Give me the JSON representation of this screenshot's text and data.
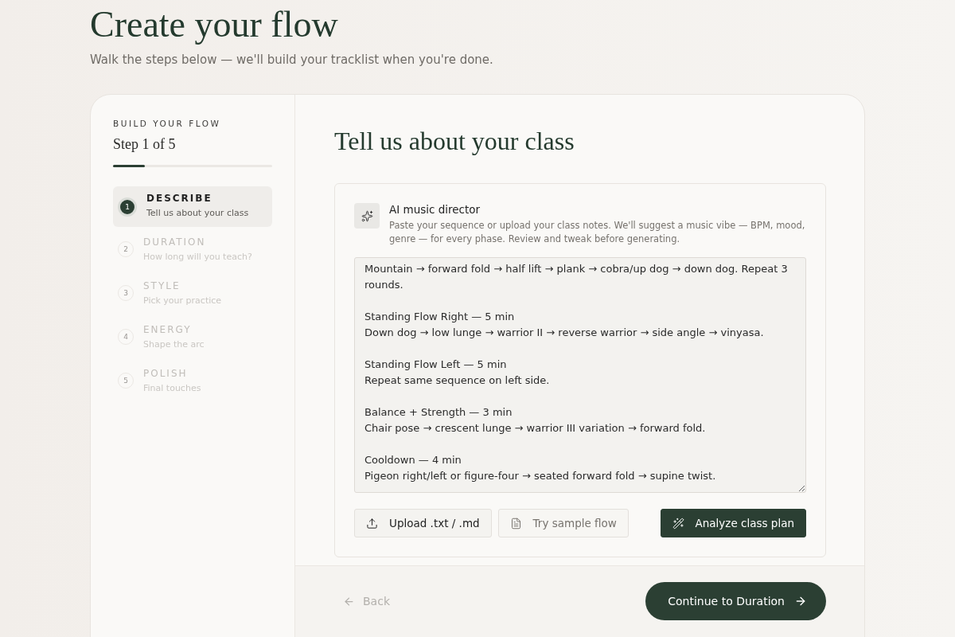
{
  "header": {
    "title": "Create your flow",
    "subtitle": "Walk the steps below — we'll build your tracklist when you're done."
  },
  "sidebar": {
    "eyebrow": "BUILD YOUR FLOW",
    "step_label": "Step 1 of 5",
    "progress": {
      "level": 0.2
    },
    "steps": [
      {
        "number": "1",
        "title": "DESCRIBE",
        "subtitle": "Tell us about your class",
        "selected": true
      },
      {
        "number": "2",
        "title": "DURATION",
        "subtitle": "How long will you teach?",
        "selected": false
      },
      {
        "number": "3",
        "title": "STYLE",
        "subtitle": "Pick your practice",
        "selected": false
      },
      {
        "number": "4",
        "title": "ENERGY",
        "subtitle": "Shape the arc",
        "selected": false
      },
      {
        "number": "5",
        "title": "POLISH",
        "subtitle": "Final touches",
        "selected": false
      }
    ]
  },
  "main": {
    "title": "Tell us about your class",
    "director": {
      "title": "AI music director",
      "description": "Paste your sequence or upload your class notes. We'll suggest a music vibe — BPM, mood, genre — for every phase. Review and tweak before generating.",
      "class_plan": "Mountain → forward fold → half lift → plank → cobra/up dog → down dog. Repeat 3 rounds.\n\nStanding Flow Right — 5 min\nDown dog → low lunge → warrior II → reverse warrior → side angle → vinyasa.\n\nStanding Flow Left — 5 min\nRepeat same sequence on left side.\n\nBalance + Strength — 3 min\nChair pose → crescent lunge → warrior III variation → forward fold.\n\nCooldown — 4 min\nPigeon right/left or figure-four → seated forward fold → supine twist.",
      "buttons": [
        {
          "kind": "upload",
          "label": "Upload .txt / .md"
        },
        {
          "kind": "sample",
          "label": "Try sample flow"
        },
        {
          "kind": "analyze",
          "label": "Analyze class plan"
        }
      ]
    },
    "footer": {
      "back": "Back",
      "continue": "Continue to Duration"
    }
  }
}
